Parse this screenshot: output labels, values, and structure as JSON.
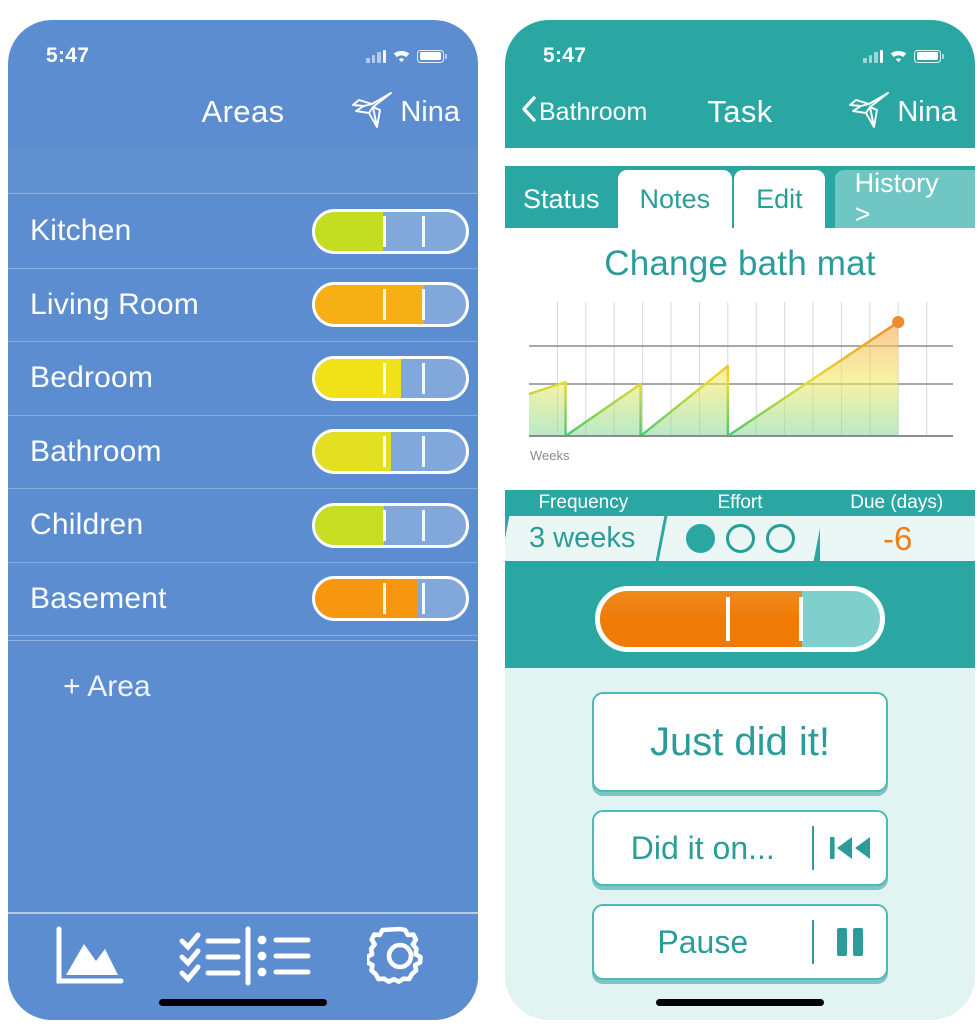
{
  "brand": {
    "name": "Nina",
    "logo_icon": "origami-bird-icon"
  },
  "status_bar": {
    "time": "5:47",
    "signal_icon": "cellular-signal-icon",
    "wifi_icon": "wifi-icon",
    "battery_icon": "battery-icon"
  },
  "left_screen": {
    "nav": {
      "title": "Areas"
    },
    "add_label": "+ Area",
    "areas": [
      {
        "name": "Kitchen",
        "progress": 45,
        "color": "#c3dd21"
      },
      {
        "name": "Living Room",
        "progress": 72,
        "color": "#f6b016"
      },
      {
        "name": "Bedroom",
        "progress": 57,
        "color": "#f0e119"
      },
      {
        "name": "Bathroom",
        "progress": 50,
        "color": "#e2e020"
      },
      {
        "name": "Children",
        "progress": 46,
        "color": "#c6dd21"
      },
      {
        "name": "Basement",
        "progress": 68,
        "color": "#f79711"
      }
    ],
    "tabbar": [
      {
        "icon": "chart-area-icon",
        "name": "tab-stats"
      },
      {
        "icon": "checklist-icon",
        "name": "tab-lists"
      },
      {
        "icon": "gear-icon",
        "name": "tab-settings"
      }
    ]
  },
  "right_screen": {
    "nav": {
      "back_label": "Bathroom",
      "title": "Task"
    },
    "tabs": [
      {
        "label": "Status",
        "state": "active"
      },
      {
        "label": "Notes",
        "state": "card"
      },
      {
        "label": "Edit",
        "state": "card"
      },
      {
        "label": "History >",
        "state": "ghost"
      }
    ],
    "task_title": "Change bath mat",
    "stats": {
      "headers": [
        "Frequency",
        "Effort",
        "Due (days)"
      ],
      "frequency": "3 weeks",
      "effort_filled": 1,
      "effort_total": 3,
      "due_days": "-6",
      "due_color": "#f07e16"
    },
    "overdue_pill": {
      "progress": 72,
      "color": "#f07a06",
      "track": "#7fcfcd"
    },
    "actions": [
      {
        "label": "Just did it!",
        "icon": "",
        "style": "primary"
      },
      {
        "label": "Did it on...",
        "icon": "rewind-icon",
        "style": "row"
      },
      {
        "label": "Pause",
        "icon": "pause-icon",
        "style": "row"
      }
    ]
  },
  "chart_data": {
    "type": "area",
    "title": "Change bath mat",
    "xlabel": "Weeks",
    "ylabel": "",
    "grid": true,
    "legend": false,
    "xlim": [
      0,
      14
    ],
    "ylim": [
      0,
      1.25
    ],
    "reference_lines": [
      0.62,
      1.0
    ],
    "series": [
      {
        "name": "Overdue level",
        "x": [
          0,
          1.35,
          1.35,
          4.25,
          4.25,
          8.1,
          8.1,
          13.2
        ],
        "y": [
          0.38,
          0.72,
          0.0,
          0.58,
          0.0,
          0.85,
          0.0,
          1.06
        ]
      }
    ],
    "marker": {
      "x": 13.2,
      "y": 1.06,
      "color": "#f08a2a"
    },
    "gridline_count": 14,
    "colors": {
      "low": "#7fd89a",
      "mid": "#f2e85a",
      "high": "#f5a85a"
    }
  }
}
